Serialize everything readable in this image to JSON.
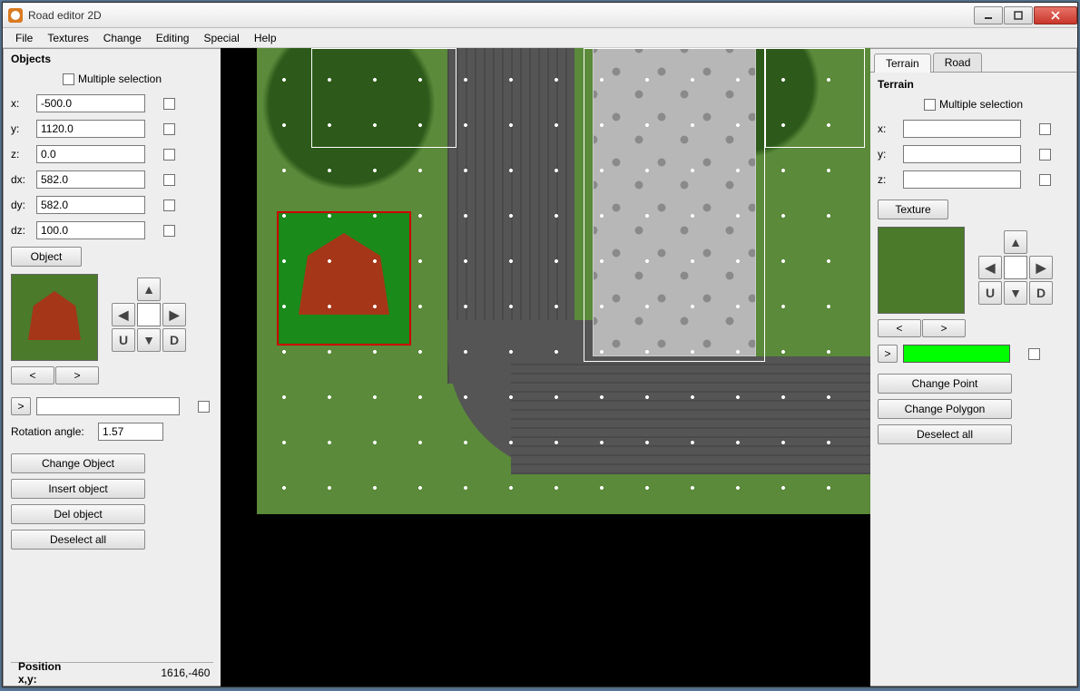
{
  "window": {
    "title": "Road editor 2D"
  },
  "menu": [
    "File",
    "Textures",
    "Change",
    "Editing",
    "Special",
    "Help"
  ],
  "left": {
    "title": "Objects",
    "multiple_selection": "Multiple selection",
    "fields": {
      "x": {
        "label": "x:",
        "value": "-500.0"
      },
      "y": {
        "label": "y:",
        "value": "1120.0"
      },
      "z": {
        "label": "z:",
        "value": "0.0"
      },
      "dx": {
        "label": "dx:",
        "value": "582.0"
      },
      "dy": {
        "label": "dy:",
        "value": "582.0"
      },
      "dz": {
        "label": "dz:",
        "value": "100.0"
      }
    },
    "object_btn": "Object",
    "prev_btn": "<",
    "next_btn": ">",
    "tag_btn": ">",
    "rotation_label": "Rotation angle:",
    "rotation_value": "1.57",
    "nav": {
      "up": "▲",
      "down": "▼",
      "left": "◀",
      "right": "▶",
      "u": "U",
      "d": "D",
      "value": ""
    },
    "buttons": {
      "change": "Change Object",
      "insert": "Insert object",
      "del": "Del object",
      "deselect": "Deselect all"
    }
  },
  "right": {
    "tabs": {
      "terrain": "Terrain",
      "road": "Road"
    },
    "title": "Terrain",
    "multiple_selection": "Multiple selection",
    "fields": {
      "x": {
        "label": "x:",
        "value": ""
      },
      "y": {
        "label": "y:",
        "value": ""
      },
      "z": {
        "label": "z:",
        "value": ""
      }
    },
    "texture_btn": "Texture",
    "nav": {
      "up": "▲",
      "down": "▼",
      "left": "◀",
      "right": "▶",
      "u": "U",
      "d": "D",
      "value": ""
    },
    "prev_btn": "<",
    "next_btn": ">",
    "tag_btn": ">",
    "color": "#00ff00",
    "buttons": {
      "change_point": "Change Point",
      "change_polygon": "Change Polygon",
      "deselect": "Deselect all"
    }
  },
  "status": {
    "label": "Position x,y:",
    "value": "1616,-460"
  }
}
